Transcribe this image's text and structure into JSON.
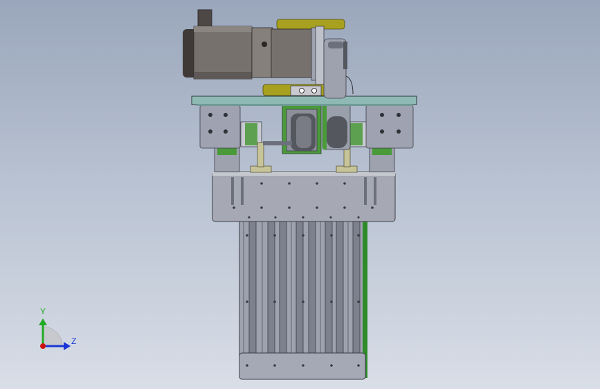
{
  "triad": {
    "y_label": "Y",
    "z_label": "Z",
    "y_color": "#22aa22",
    "z_color": "#1a36d6",
    "x_color": "#cc1111"
  },
  "colors": {
    "motor_body": "#77716e",
    "motor_dark": "#4d4845",
    "gear_olive": "#a7a11f",
    "plate_teal": "#8fb9b4",
    "steel_grey": "#9ea1ae",
    "steel_dark": "#6c6f7c",
    "spring_green": "#4a9a3a",
    "tan_support": "#c7c49a"
  }
}
